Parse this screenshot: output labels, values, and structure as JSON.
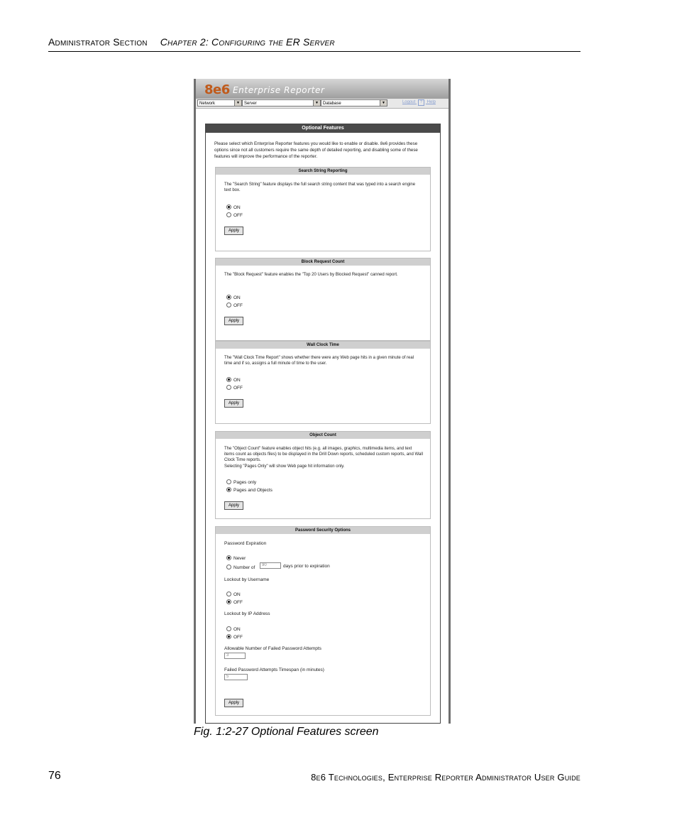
{
  "doc": {
    "header_left": "Administrator Section",
    "header_right": "Chapter 2: Configuring the ER Server",
    "caption": "Fig. 1:2-27  Optional Features screen",
    "page_number": "76",
    "footer": "8e6 Technologies, Enterprise Reporter Administrator User Guide"
  },
  "app": {
    "logo": "8e6",
    "name": "Enterprise Reporter",
    "menus": [
      "Network",
      "Server",
      "Database"
    ],
    "logout": "Logout",
    "help": "Help",
    "help_icon_glyph": "?"
  },
  "panel": {
    "title": "Optional Features",
    "intro": "Please select which Enterprise Reporter features you would like to enable or disable. 8e6 provides these options since not all customers require the same depth of detailed reporting, and disabling some of these features will improve the performance of the reporter."
  },
  "search_string": {
    "title": "Search String Reporting",
    "text": "The \"Search String\" feature displays the full search string content that was typed into a search engine text box.",
    "on": "ON",
    "off": "OFF",
    "selected": "on",
    "apply": "Apply"
  },
  "block_request": {
    "title": "Block Request Count",
    "text": "The \"Block Request\" feature enables the \"Top 20 Users by Blocked Request\" canned report.",
    "on": "ON",
    "off": "OFF",
    "selected": "on",
    "apply": "Apply"
  },
  "wall_clock": {
    "title": "Wall Clock Time",
    "text": "The \"Wall Clock Time Report\" shows whether there were any Web page hits in a given minute of real time and if so, assigns a full minute of time to the user.",
    "on": "ON",
    "off": "OFF",
    "selected": "on",
    "apply": "Apply"
  },
  "object_count": {
    "title": "Object Count",
    "text": "The \"Object Count\" feature enables object hits (e.g. all images, graphics, multimedia items, and text items count as objects files) to be displayed in the Drill Down reports, scheduled custom reports, and Wall Clock Time reports.",
    "text2": "Selecting \"Pages Only\" will show Web page hit information only.",
    "opt1": "Pages only",
    "opt2": "Pages and Objects",
    "selected": "opt2",
    "apply": "Apply"
  },
  "password": {
    "title": "Password Security Options",
    "expiration_label": "Password Expiration",
    "never": "Never",
    "number_of": "Number of",
    "days_value": "90",
    "days_suffix": "days prior to expiration",
    "lockout_user_label": "Lockout by Username",
    "lockout_ip_label": "Lockout by IP Address",
    "on": "ON",
    "off": "OFF",
    "attempts_label": "Allowable Number of Failed Password Attempts",
    "attempts_value": "3",
    "timespan_label": "Failed Password Attempts Timespan (in minutes)",
    "timespan_value": "5",
    "apply": "Apply"
  }
}
